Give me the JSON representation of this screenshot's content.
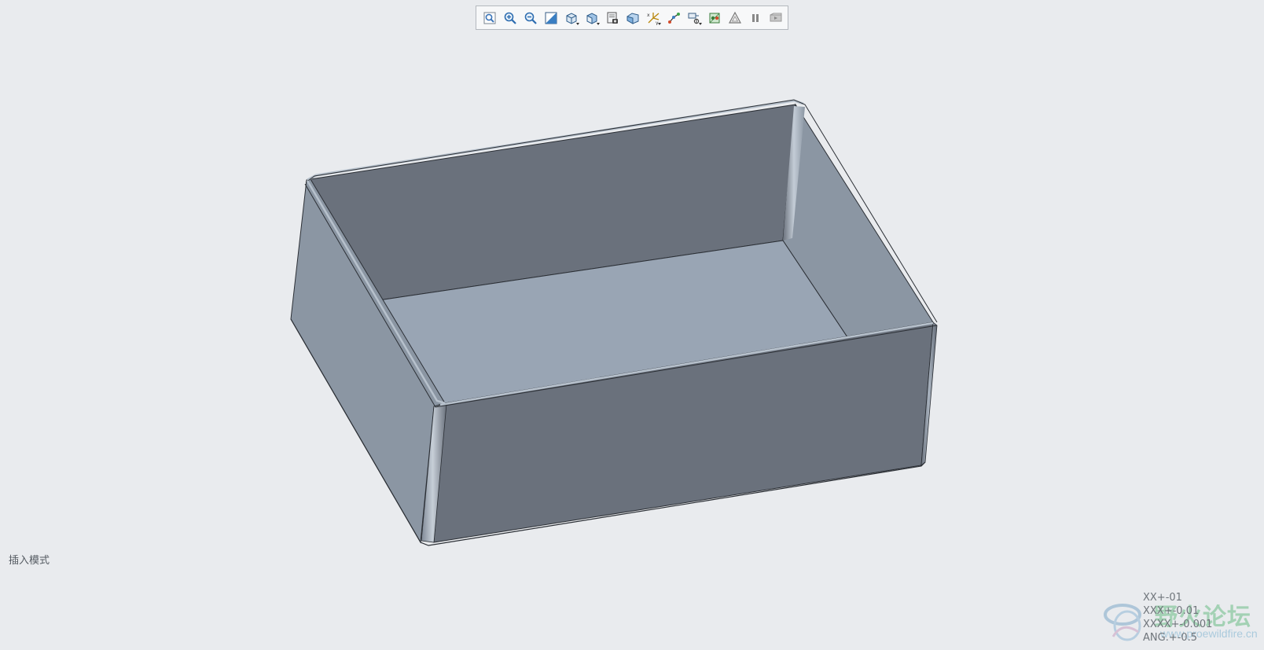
{
  "toolbar": {
    "items": [
      {
        "name": "refit-icon"
      },
      {
        "name": "zoom-in-icon"
      },
      {
        "name": "zoom-out-icon"
      },
      {
        "name": "repaint-icon"
      },
      {
        "name": "display-style-icon"
      },
      {
        "name": "saved-orientations-icon"
      },
      {
        "name": "view-manager-icon"
      },
      {
        "name": "perspective-view-icon"
      },
      {
        "name": "datum-display-icon"
      },
      {
        "name": "annotation-display-icon"
      },
      {
        "name": "spin-center-icon"
      },
      {
        "name": "appearance-icon"
      },
      {
        "name": "simulation-icon"
      },
      {
        "name": "pause-icon"
      },
      {
        "name": "playback-icon"
      }
    ]
  },
  "status": {
    "mode_label": "插入模式"
  },
  "tolerances": {
    "lines": [
      "XX+-01",
      "XXX+-0.01",
      "XXXX+-0.001",
      "ANG.+-0.5"
    ]
  },
  "watermark": {
    "title": "野火论坛",
    "url": "www.proewildfire.cn"
  },
  "colors": {
    "background": "#e9ebee",
    "wall_dark": "#6a717c",
    "wall_light": "#8b96a3",
    "floor": "#99a5b4",
    "rim": "#b7c1cc",
    "edge": "#2b2f35"
  }
}
